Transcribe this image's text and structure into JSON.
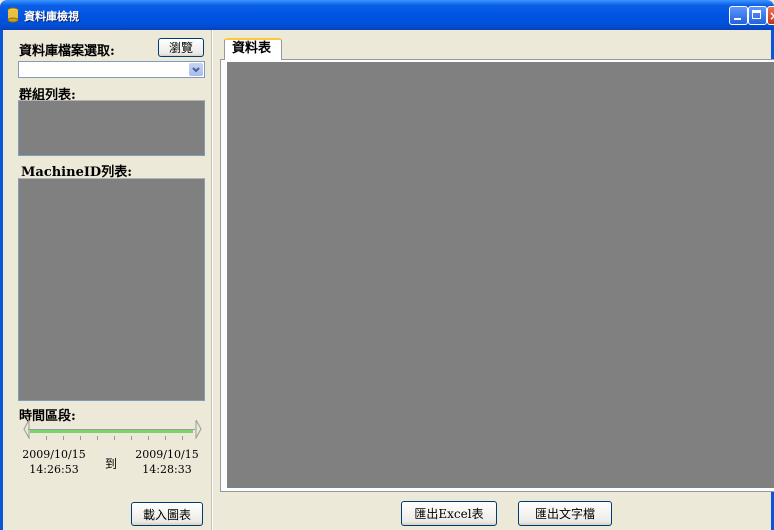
{
  "window": {
    "title": "資料庫檢視"
  },
  "left_panel": {
    "db_file_label": "資料庫檔案選取:",
    "browse_button": "瀏覽",
    "db_combo_value": "",
    "group_list_label": "群組列表:",
    "machine_list_label": "MachineID列表:",
    "time_range_label": "時間區段:",
    "start_date": "2009/10/15",
    "start_time": "14:26:53",
    "to_label": "到",
    "end_date": "2009/10/15",
    "end_time": "14:28:33",
    "load_chart_button": "載入圖表"
  },
  "main": {
    "tabs": [
      {
        "label": "資料表"
      }
    ],
    "export_excel_button": "匯出Excel表",
    "export_text_button": "匯出文字檔"
  },
  "colors": {
    "titlebar": "#0054e3",
    "list_background": "#808080",
    "range_fill": "#7bd36c",
    "tab_accent": "#ffc83c"
  },
  "icons": [
    "app-icon",
    "minimize-icon",
    "maximize-icon",
    "close-icon",
    "chevron-down-icon"
  ]
}
